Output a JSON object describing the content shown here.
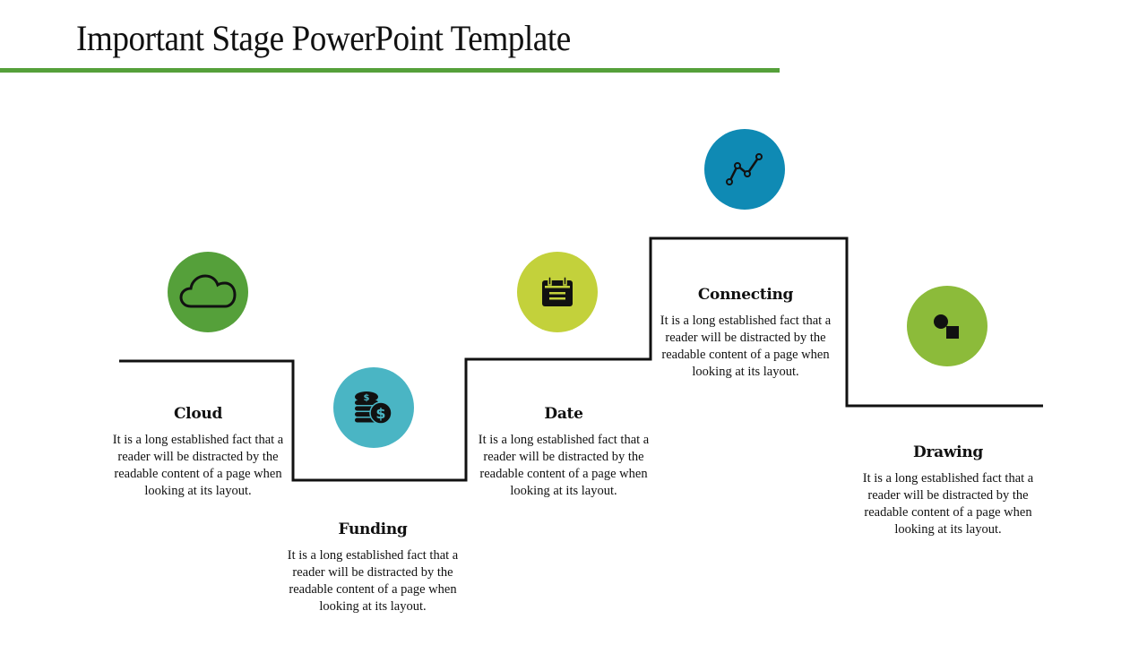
{
  "slide": {
    "title": "Important Stage PowerPoint Template",
    "accent_color": "#55a03a"
  },
  "stages": [
    {
      "title": "Cloud",
      "icon": "cloud-icon",
      "color": "#55a03a",
      "text": "It is a long established fact that a reader will be distracted by the readable content of a page when looking at its layout."
    },
    {
      "title": "Funding",
      "icon": "coins-dollar-icon",
      "color": "#4ab5c4",
      "text": "It is a long established fact that a reader will be distracted by the readable content of a page when looking at its layout."
    },
    {
      "title": "Date",
      "icon": "calendar-icon",
      "color": "#c3d13b",
      "text": "It is a long established fact that a reader will be distracted by the readable content of a page when looking at its layout."
    },
    {
      "title": "Connecting",
      "icon": "line-chart-icon",
      "color": "#0f8ab4",
      "text": "It is a long established fact that a reader will be distracted by the readable content of a page when looking at its layout."
    },
    {
      "title": "Drawing",
      "icon": "shapes-icon",
      "color": "#8cbb3a",
      "text": "It is a long established fact that a reader will be distracted by the readable content of a page when looking at its layout."
    }
  ]
}
